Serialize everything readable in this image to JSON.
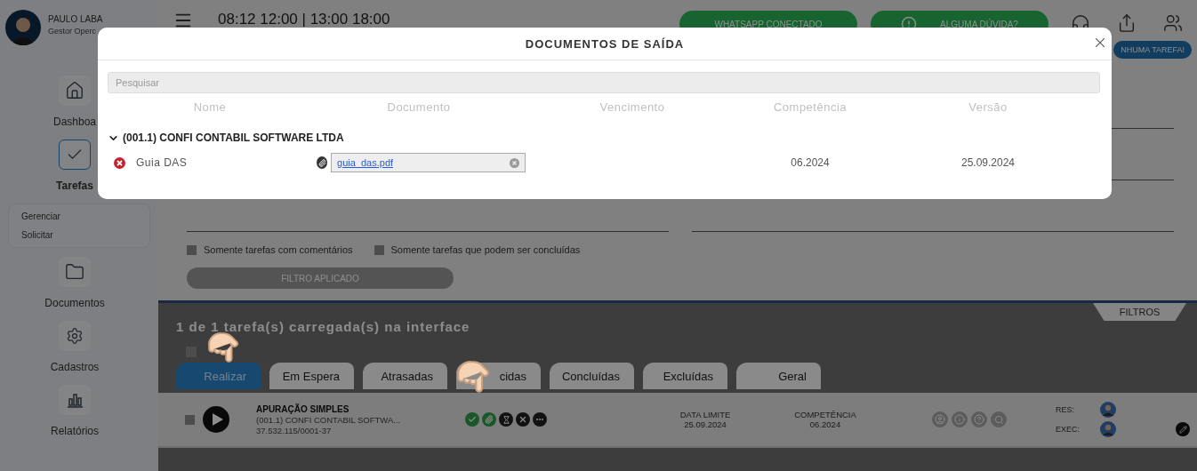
{
  "user": {
    "name": "PAULO LABA",
    "role": "Gestor Operc"
  },
  "nav": [
    {
      "label": "Dashboa",
      "selected": false
    },
    {
      "label": "Tarefas",
      "selected": true,
      "submenu": [
        "Gerenciar",
        "Solicitar"
      ]
    },
    {
      "label": "Documentos",
      "selected": false
    },
    {
      "label": "Cadastros",
      "selected": false
    },
    {
      "label": "Relatórios",
      "selected": false
    }
  ],
  "header": {
    "schedule": "08:12 12:00 | 13:00 18:00",
    "buttons": [
      {
        "label": "WHATSAPP CONECTADO",
        "kind": "plain"
      },
      {
        "label": "ALGUMA DÚVIDA?",
        "kind": "icon"
      }
    ],
    "badge": "NHUMA TAREFA!"
  },
  "filters": {
    "options": [
      {
        "label": "Somente tarefas com comentários",
        "checked": false
      },
      {
        "label": "Somente tarefas que podem ser concluídas",
        "checked": false
      }
    ],
    "apply_button": "FILTRO APLICADO",
    "toggle": "FILTROS"
  },
  "tasks": {
    "summary": "1 de 1 tarefa(s) carregada(s) na interface",
    "select_all_checked": false,
    "tabs": [
      {
        "label": "Realizar",
        "selected": true
      },
      {
        "label": "Em Espera",
        "selected": false
      },
      {
        "label": "Atrasadas",
        "selected": false
      },
      {
        "label": "cidas",
        "selected": false
      },
      {
        "label": "Concluídas",
        "selected": false
      },
      {
        "label": "Excluídas",
        "selected": false
      },
      {
        "label": "Geral",
        "selected": false
      }
    ],
    "rows": [
      {
        "title": "APURAÇÃO SIMPLES",
        "company": "(001.1) CONFI CONTABIL SOFTWA...",
        "cnpj": "37.532.115/0001-37",
        "checked": false,
        "due_label": "DATA LIMITE",
        "due": "25.09.2024",
        "competence_label": "COMPETÊNCIA",
        "competence": "06.2024",
        "res_label": "RES:",
        "exec_label": "EXEC:"
      }
    ]
  },
  "modal": {
    "title": "DOCUMENTOS DE SAÍDA",
    "search": {
      "placeholder": "Pesquisar"
    },
    "columns": [
      "Nome",
      "Documento",
      "Vencimento",
      "Competência",
      "Versão"
    ],
    "groups": [
      {
        "name": "(001.1) CONFI CONTABIL SOFTWARE LTDA",
        "expanded": true,
        "documents": [
          {
            "name": "Guia DAS",
            "file": "guia_das.pdf",
            "competence": "06.2024",
            "version": "25.09.2024"
          }
        ]
      }
    ]
  }
}
